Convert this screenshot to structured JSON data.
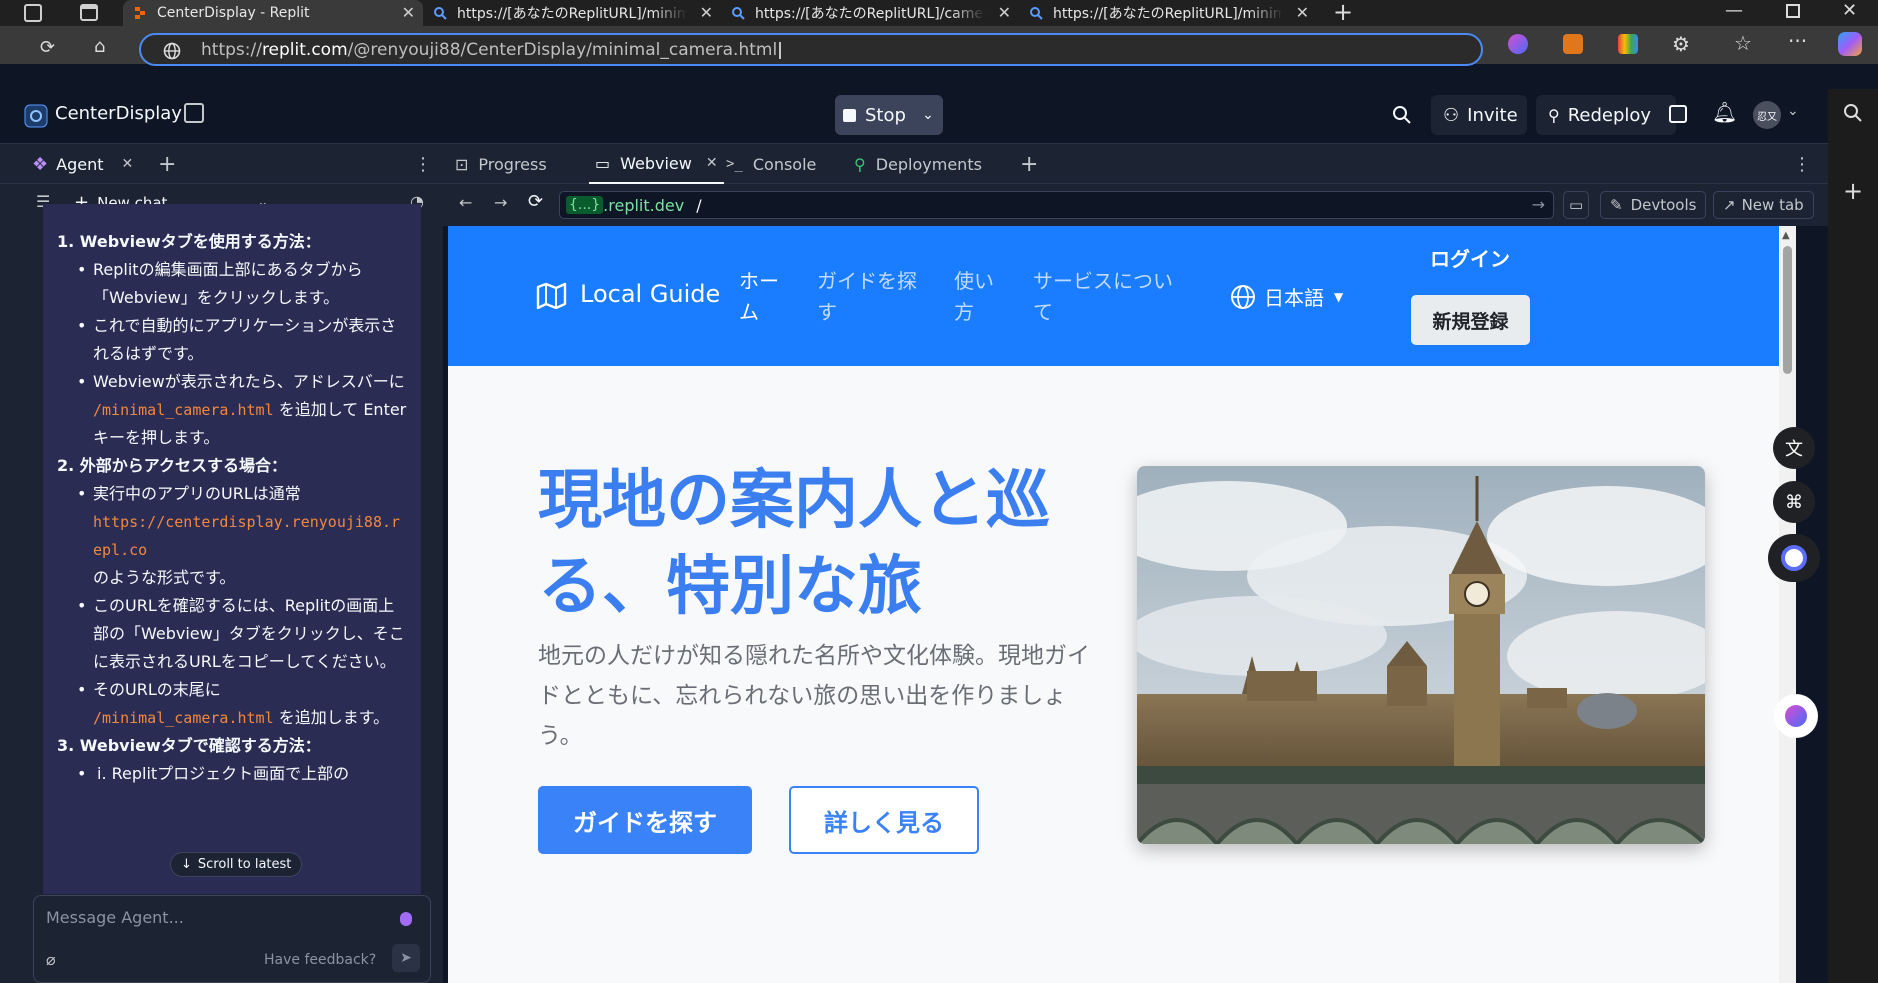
{
  "browser": {
    "tabs": [
      {
        "title": "CenterDisplay - Replit",
        "active": true
      },
      {
        "title": "https://[あなたのReplitURL]/minimal_camera.html",
        "active": false
      },
      {
        "title": "https://[あなたのReplitURL]/camera.html",
        "active": false
      },
      {
        "title": "https://[あなたのReplitURL]/minimal_camera.html",
        "active": false
      }
    ],
    "url_prefix": "https://",
    "url_host": "replit.com",
    "url_path": "/@renyouji88/CenterDisplay/minimal_camera.html"
  },
  "replit": {
    "project_name": "CenterDisplay",
    "stop_label": "Stop",
    "invite_label": "Invite",
    "redeploy_label": "Redeploy",
    "avatar_text": "忍又"
  },
  "agent": {
    "tab_label": "Agent",
    "new_chat_label": "New chat",
    "steps": [
      {
        "heading": "1. Webviewタブを使用する方法：",
        "bullets": [
          {
            "text": "Replitの編集画面上部にあるタブから「Webview」をクリックします。"
          },
          {
            "text": "これで自動的にアプリケーションが表示されるはずです。"
          },
          {
            "before": "Webviewが表示されたら、アドレスバーに ",
            "code": "/minimal_camera.html",
            "after": " を追加して Enter キーを押します。"
          }
        ]
      },
      {
        "heading": "2. 外部からアクセスする場合：",
        "bullets": [
          {
            "before": "実行中のアプリのURLは通常 ",
            "code": "https://centerdisplay.renyouji88.repl.co",
            "after": " のような形式です。"
          },
          {
            "text": "このURLを確認するには、Replitの画面上部の「Webview」タブをクリックし、そこに表示されるURLをコピーしてください。"
          },
          {
            "before": "そのURLの末尾に ",
            "code": "/minimal_camera.html",
            "after": " を追加します。"
          }
        ]
      },
      {
        "heading": "3. Webviewタブで確認する方法：",
        "bullets": [
          {
            "text": "i. Replitプロジェクト画面で上部の"
          }
        ]
      }
    ],
    "scroll_latest_label": "Scroll to latest",
    "message_placeholder": "Message Agent...",
    "feedback_label": "Have feedback?"
  },
  "workspace_tabs": [
    "Progress",
    "Webview",
    "Console",
    "Deployments"
  ],
  "webview": {
    "host_badge": "{...}",
    "host": ".replit.dev",
    "path": "/",
    "devtools_label": "Devtools",
    "newtab_label": "New tab"
  },
  "site": {
    "brand": "Local Guide",
    "nav": [
      {
        "line1": "ホー",
        "line2": "ム",
        "active": true
      },
      {
        "line1": "ガイドを探",
        "line2": "す",
        "active": false
      },
      {
        "line1": "使い",
        "line2": "方",
        "active": false
      },
      {
        "line1": "サービスについ",
        "line2": "て",
        "active": false
      }
    ],
    "language": "日本語",
    "login": "ログイン",
    "register": "新規登録",
    "hero_title_line1": "現地の案内人と巡",
    "hero_title_line2": "る、特別な旅",
    "hero_sub": "地元の人だけが知る隠れた名所や文化体験。現地ガイドとともに、忘れられない旅の思い出を作りましょう。",
    "btn_primary": "ガイドを探す",
    "btn_secondary": "詳しく見る"
  },
  "colors": {
    "site_blue": "#1a7cff",
    "button_blue": "#3a82f7",
    "replit_bg": "#0e1525",
    "agent_bg": "#2b2c54"
  }
}
